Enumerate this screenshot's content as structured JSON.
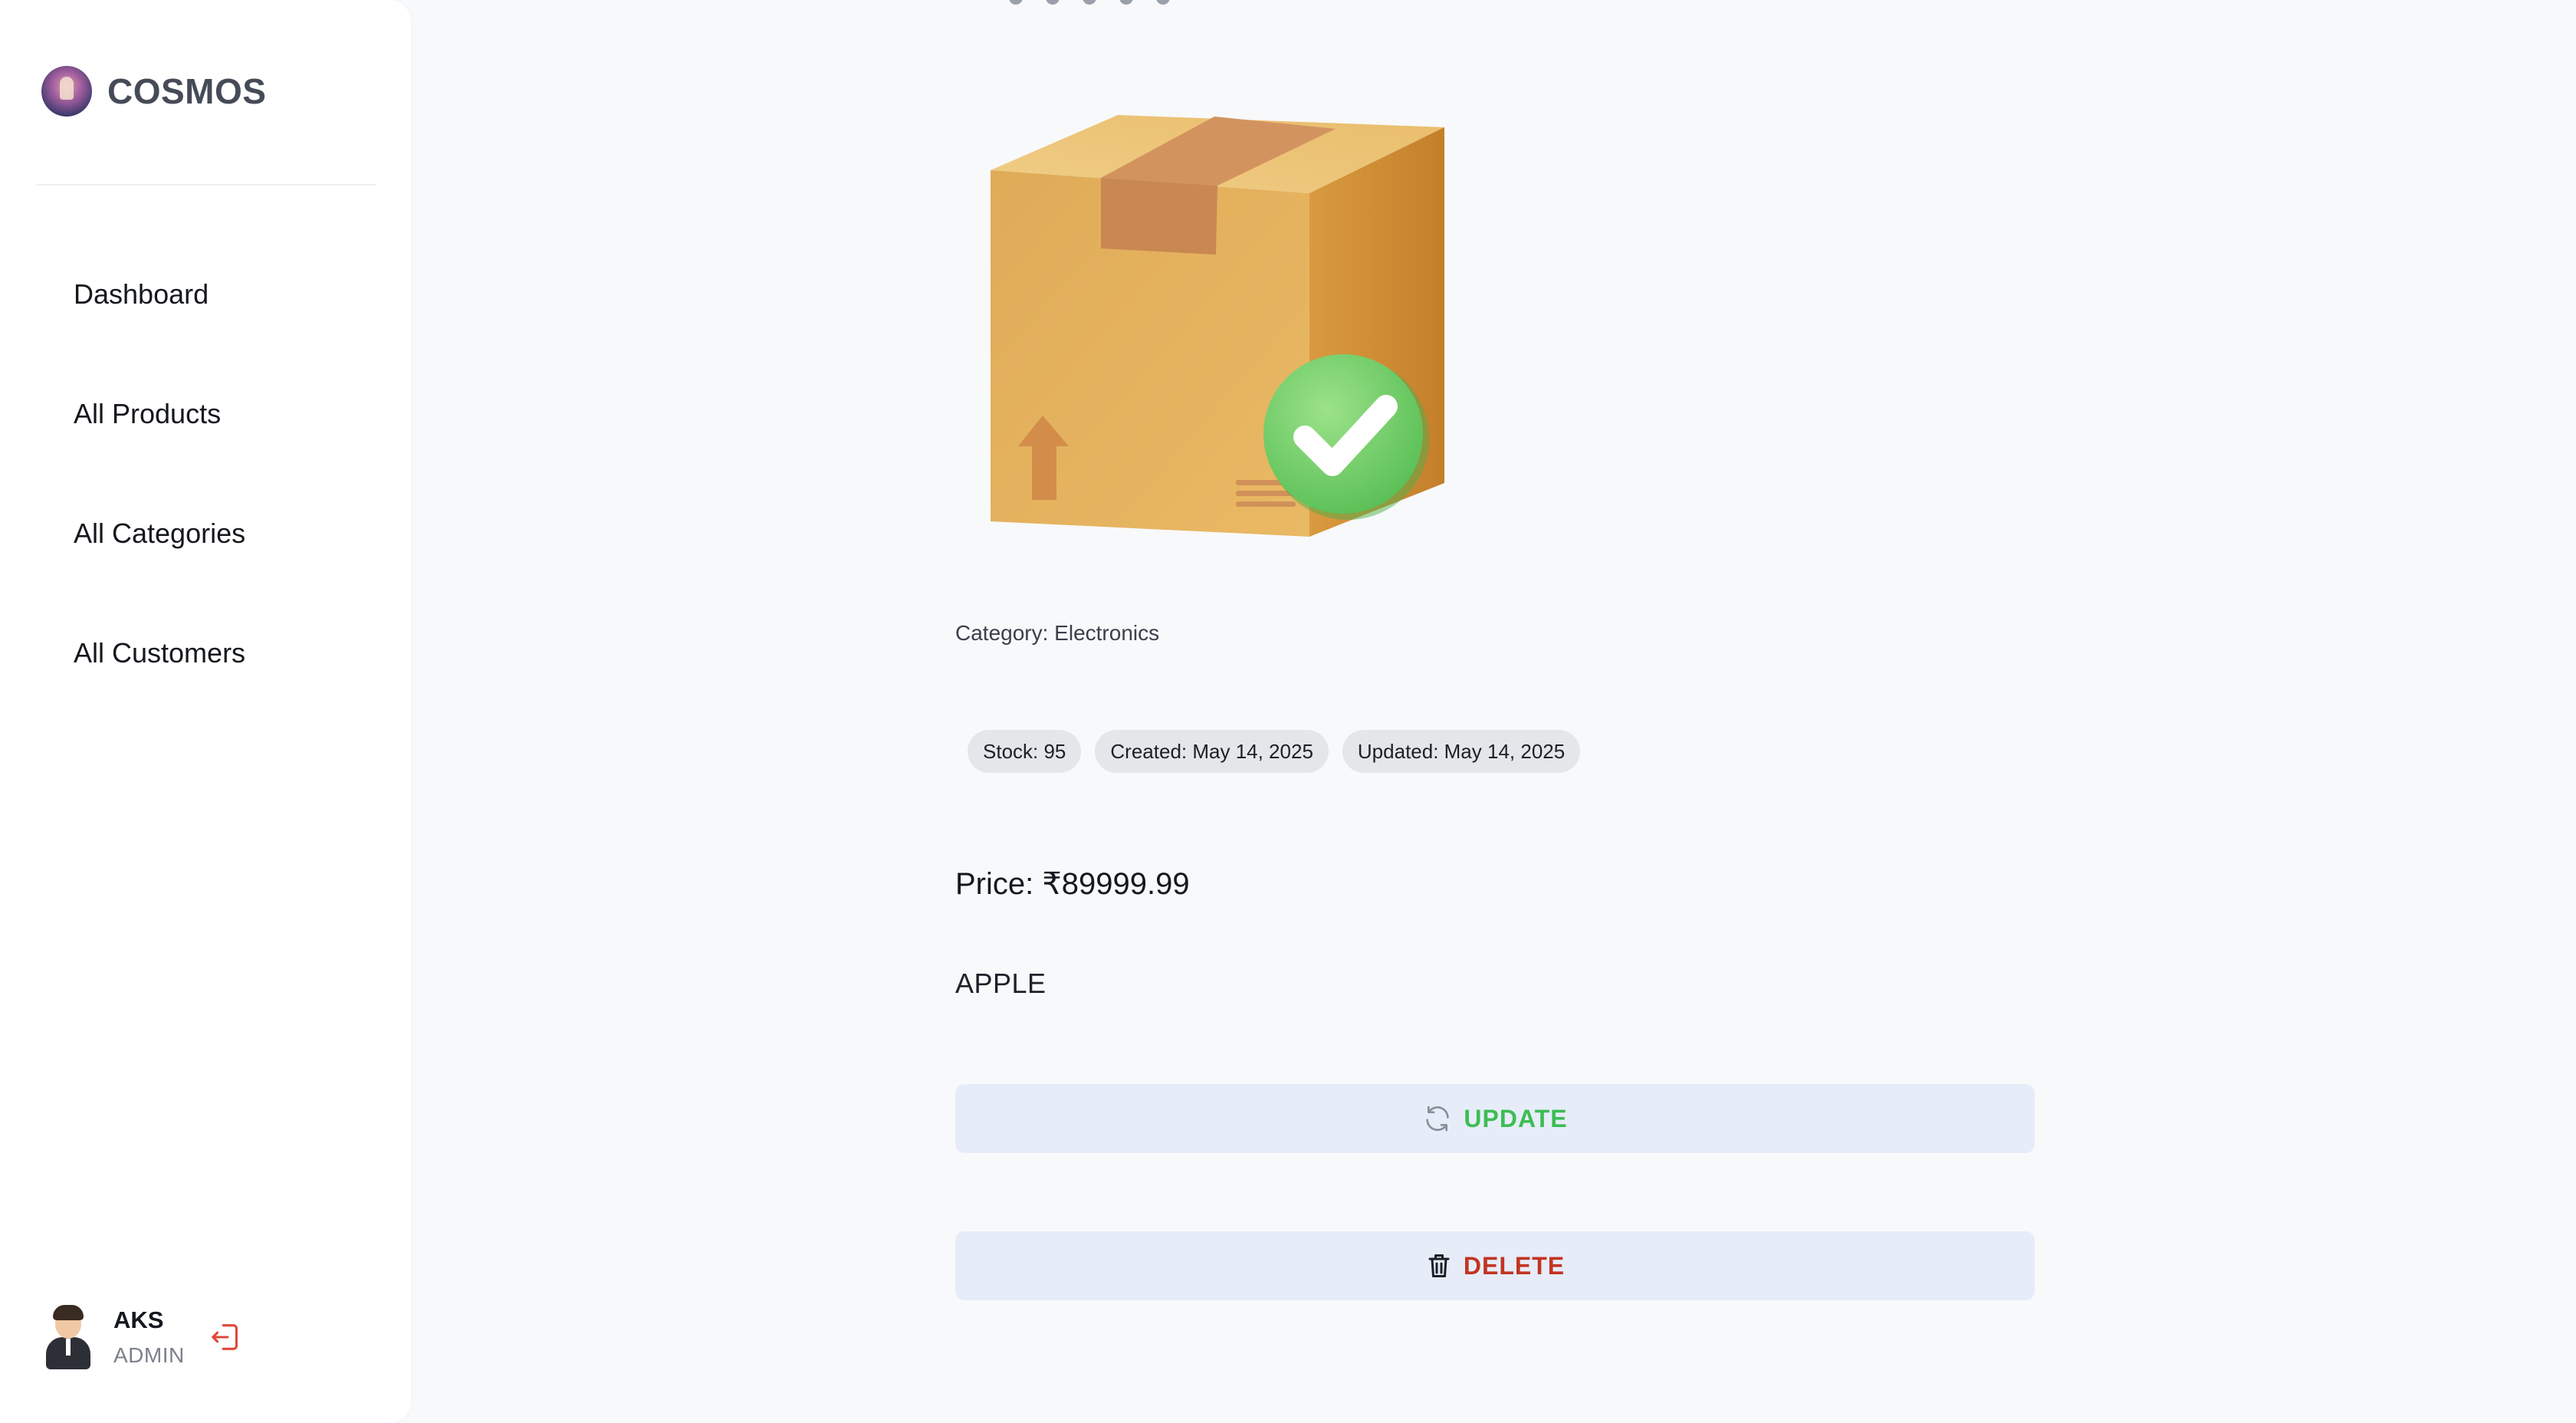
{
  "app": {
    "name": "COSMOS"
  },
  "sidebar": {
    "items": [
      {
        "label": "Dashboard"
      },
      {
        "label": "All Products"
      },
      {
        "label": "All Categories"
      },
      {
        "label": "All Customers"
      }
    ]
  },
  "user": {
    "name": "AKS",
    "role": "ADMIN"
  },
  "product": {
    "category": "Category: Electronics",
    "chips": {
      "stock": "Stock: 95",
      "created": "Created: May 14, 2025",
      "updated": "Updated: May 14, 2025"
    },
    "price": "Price: ₹89999.99",
    "brand": "APPLE"
  },
  "actions": {
    "update_label": "UPDATE",
    "delete_label": "DELETE"
  },
  "icons": {
    "logout": "logout-icon",
    "update": "refresh-icon",
    "delete": "trash-icon"
  },
  "colors": {
    "update_text": "#3dbd54",
    "delete_text": "#c23423",
    "button_bg": "#e6edf8",
    "logout_icon": "#e0473a"
  }
}
